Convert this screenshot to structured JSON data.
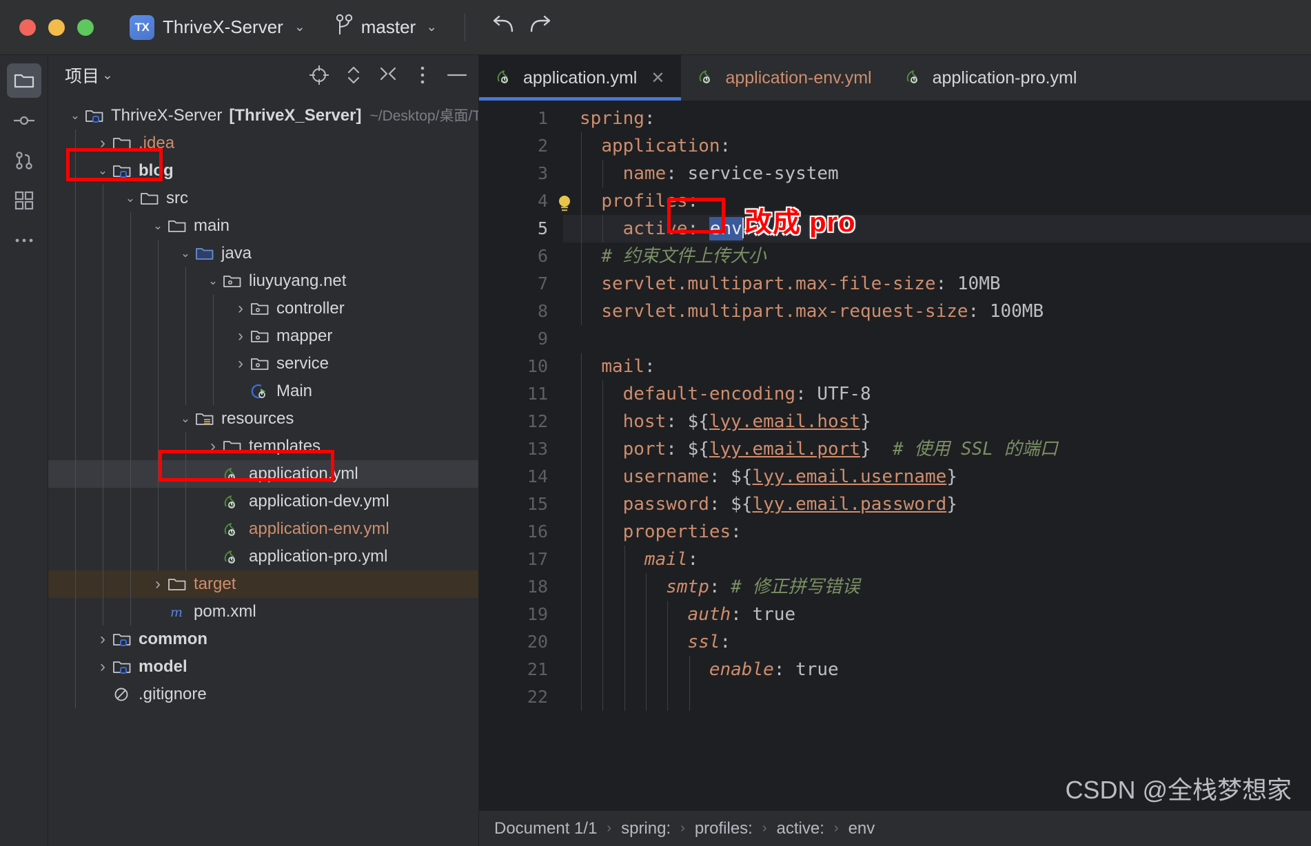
{
  "titlebar": {
    "window_controls": [
      "close",
      "minimize",
      "zoom"
    ],
    "project_badge": "TX",
    "project_name": "ThriveX-Server",
    "branch_name": "master",
    "undo_icon": "undo-icon",
    "redo_icon": "redo-icon",
    "vcs_icon": "vcs-branch-icon"
  },
  "rail": {
    "items": [
      {
        "name": "project-tool-window",
        "icon": "folder-icon",
        "active": true
      },
      {
        "name": "commit-tool-window",
        "icon": "commit-icon",
        "active": false
      },
      {
        "name": "pull-requests-tool-window",
        "icon": "pull-request-icon",
        "active": false
      },
      {
        "name": "structure-tool-window",
        "icon": "structure-icon",
        "active": false
      },
      {
        "name": "more-tool-windows",
        "icon": "more-dots-icon",
        "active": false
      }
    ]
  },
  "project_panel": {
    "title": "项目",
    "title_chevron": "chevron-down-icon",
    "header_actions": [
      {
        "name": "select-opened-file-button",
        "icon": "target-icon"
      },
      {
        "name": "expand-collapse-button",
        "icon": "expand-collapse-icon"
      },
      {
        "name": "collapse-all-button",
        "icon": "collapse-all-icon"
      },
      {
        "name": "options-button",
        "icon": "vertical-dots-icon"
      },
      {
        "name": "hide-button",
        "icon": "minus-icon"
      }
    ],
    "tree": [
      {
        "depth": 0,
        "twisty": "v",
        "icon": "module-folder-icon",
        "label": "ThriveX-Server",
        "bold_suffix": "[ThriveX_Server]",
        "dim": "~/Desktop/桌面/Thriv",
        "state": "none"
      },
      {
        "depth": 1,
        "twisty": ">",
        "icon": "folder-icon",
        "label": ".idea",
        "color": "orange",
        "state": "none"
      },
      {
        "depth": 1,
        "twisty": "v",
        "icon": "module-folder-icon",
        "label": "blog",
        "bold": true,
        "state": "none",
        "annotated": true
      },
      {
        "depth": 2,
        "twisty": "v",
        "icon": "folder-icon",
        "label": "src",
        "state": "none"
      },
      {
        "depth": 3,
        "twisty": "v",
        "icon": "folder-icon",
        "label": "main",
        "state": "none"
      },
      {
        "depth": 4,
        "twisty": "v",
        "icon": "source-root-folder-icon",
        "label": "java",
        "state": "none"
      },
      {
        "depth": 5,
        "twisty": "v",
        "icon": "package-icon",
        "label": "liuyuyang.net",
        "state": "none"
      },
      {
        "depth": 6,
        "twisty": ">",
        "icon": "package-icon",
        "label": "controller",
        "state": "none"
      },
      {
        "depth": 6,
        "twisty": ">",
        "icon": "package-icon",
        "label": "mapper",
        "state": "none"
      },
      {
        "depth": 6,
        "twisty": ">",
        "icon": "package-icon",
        "label": "service",
        "state": "none"
      },
      {
        "depth": 6,
        "twisty": "",
        "icon": "spring-main-class-icon",
        "label": "Main",
        "state": "none"
      },
      {
        "depth": 4,
        "twisty": "v",
        "icon": "resources-folder-icon",
        "label": "resources",
        "state": "none"
      },
      {
        "depth": 5,
        "twisty": ">",
        "icon": "folder-icon",
        "label": "templates",
        "state": "none"
      },
      {
        "depth": 5,
        "twisty": "",
        "icon": "spring-yaml-icon",
        "label": "application.yml",
        "state": "selected",
        "annotated": true
      },
      {
        "depth": 5,
        "twisty": "",
        "icon": "spring-yaml-icon",
        "label": "application-dev.yml",
        "state": "none"
      },
      {
        "depth": 5,
        "twisty": "",
        "icon": "spring-yaml-icon",
        "label": "application-env.yml",
        "color": "orange",
        "state": "none"
      },
      {
        "depth": 5,
        "twisty": "",
        "icon": "spring-yaml-icon",
        "label": "application-pro.yml",
        "state": "none"
      },
      {
        "depth": 3,
        "twisty": ">",
        "icon": "folder-icon",
        "label": "target",
        "color": "orange",
        "state": "brown"
      },
      {
        "depth": 3,
        "twisty": "",
        "icon": "maven-pom-icon",
        "label": "pom.xml",
        "state": "none"
      },
      {
        "depth": 1,
        "twisty": ">",
        "icon": "module-folder-icon",
        "label": "common",
        "bold": true,
        "state": "none"
      },
      {
        "depth": 1,
        "twisty": ">",
        "icon": "module-folder-icon",
        "label": "model",
        "bold": true,
        "state": "none"
      },
      {
        "depth": 1,
        "twisty": "",
        "icon": "gitignore-icon",
        "label": ".gitignore",
        "state": "none"
      }
    ]
  },
  "editor": {
    "tabs": [
      {
        "label": "application.yml",
        "icon": "spring-yaml-icon",
        "active": true,
        "closable": true,
        "close_icon": "close-icon",
        "color": "default"
      },
      {
        "label": "application-env.yml",
        "icon": "spring-yaml-icon",
        "active": false,
        "closable": false,
        "color": "orange"
      },
      {
        "label": "application-pro.yml",
        "icon": "spring-yaml-icon",
        "active": false,
        "closable": false,
        "color": "default"
      }
    ],
    "lines": [
      {
        "n": "1",
        "text": "spring:",
        "indent_guides": 0
      },
      {
        "n": "2",
        "text": "  application:",
        "indent_guides": 1
      },
      {
        "n": "3",
        "text": "    name: service-system",
        "indent_guides": 2
      },
      {
        "n": "4",
        "text": "  profiles:",
        "indent_guides": 1,
        "bulb": true
      },
      {
        "n": "5",
        "text": "    active: env",
        "indent_guides": 2,
        "current": true,
        "selection": "env",
        "caret": true
      },
      {
        "n": "6",
        "text": "  # 约束文件上传大小",
        "indent_guides": 1
      },
      {
        "n": "7",
        "text": "  servlet.multipart.max-file-size: 10MB",
        "indent_guides": 1
      },
      {
        "n": "8",
        "text": "  servlet.multipart.max-request-size: 100MB",
        "indent_guides": 1
      },
      {
        "n": "9",
        "text": "",
        "indent_guides": 0
      },
      {
        "n": "10",
        "text": "  mail:",
        "indent_guides": 1
      },
      {
        "n": "11",
        "text": "    default-encoding: UTF-8",
        "indent_guides": 2
      },
      {
        "n": "12",
        "text": "    host: ${lyy.email.host}",
        "indent_guides": 2
      },
      {
        "n": "13",
        "text": "    port: ${lyy.email.port}  # 使用 SSL 的端口",
        "indent_guides": 2
      },
      {
        "n": "14",
        "text": "    username: ${lyy.email.username}",
        "indent_guides": 2
      },
      {
        "n": "15",
        "text": "    password: ${lyy.email.password}",
        "indent_guides": 2
      },
      {
        "n": "16",
        "text": "    properties:",
        "indent_guides": 2
      },
      {
        "n": "17",
        "text": "      mail:",
        "indent_guides": 3
      },
      {
        "n": "18",
        "text": "        smtp: # 修正拼写错误",
        "indent_guides": 4
      },
      {
        "n": "19",
        "text": "          auth: true",
        "indent_guides": 5
      },
      {
        "n": "20",
        "text": "          ssl:",
        "indent_guides": 5
      },
      {
        "n": "21",
        "text": "            enable: true",
        "indent_guides": 6
      },
      {
        "n": "22",
        "text": "",
        "indent_guides": 6
      }
    ]
  },
  "breadcrumb": {
    "items": [
      "Document 1/1",
      "spring:",
      "profiles:",
      "active:",
      "env"
    ],
    "separator": "›"
  },
  "annotations": {
    "change_to_pro": "改成 pro",
    "watermark": "CSDN @全栈梦想家",
    "box_color": "#ff0000"
  }
}
